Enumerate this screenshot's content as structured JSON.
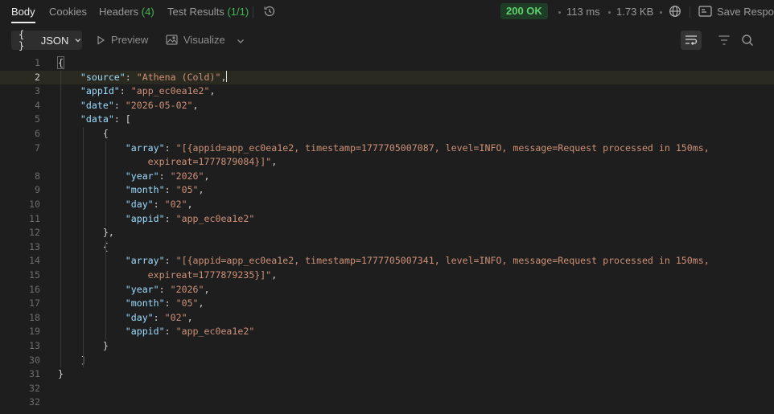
{
  "tabs": [
    {
      "label": "Body",
      "count": "",
      "active": true
    },
    {
      "label": "Cookies",
      "count": "",
      "active": false
    },
    {
      "label": "Headers",
      "count": "(4)",
      "active": false
    },
    {
      "label": "Test Results",
      "count": "(1/1)",
      "active": false
    }
  ],
  "response": {
    "status": "200 OK",
    "time": "113 ms",
    "size": "1.73 KB",
    "save_label": "Save Respo"
  },
  "toolbar": {
    "format_braces": "{ }",
    "format_label": "JSON",
    "preview_label": "Preview",
    "visualize_label": "Visualize"
  },
  "icons": {
    "history": "history-icon",
    "globe": "globe-icon",
    "save": "save-icon",
    "wrap": "wrap-lines-icon",
    "filter": "filter-icon",
    "search": "search-icon"
  },
  "colors": {
    "status_bg": "#1f3d26",
    "status_fg": "#5fd16f",
    "key": "#9cdcfe",
    "string": "#ce9178"
  },
  "editor": {
    "current_line": "2",
    "lines": [
      {
        "n": "1",
        "tokens": [
          [
            "p",
            "{"
          ]
        ]
      },
      {
        "n": "2",
        "tokens": [
          [
            "p",
            "    "
          ],
          [
            "k",
            "\"source\""
          ],
          [
            "p",
            ": "
          ],
          [
            "s",
            "\"Athena (Cold)\""
          ],
          [
            "p",
            ","
          ]
        ]
      },
      {
        "n": "3",
        "tokens": [
          [
            "p",
            "    "
          ],
          [
            "k",
            "\"appId\""
          ],
          [
            "p",
            ": "
          ],
          [
            "s",
            "\"app_ec0ea1e2\""
          ],
          [
            "p",
            ","
          ]
        ]
      },
      {
        "n": "4",
        "tokens": [
          [
            "p",
            "    "
          ],
          [
            "k",
            "\"date\""
          ],
          [
            "p",
            ": "
          ],
          [
            "s",
            "\"2026-05-02\""
          ],
          [
            "p",
            ","
          ]
        ]
      },
      {
        "n": "5",
        "tokens": [
          [
            "p",
            "    "
          ],
          [
            "k",
            "\"data\""
          ],
          [
            "p",
            ": ["
          ]
        ]
      },
      {
        "n": "6",
        "tokens": [
          [
            "p",
            "        {"
          ]
        ]
      },
      {
        "n": "7",
        "tokens": [
          [
            "p",
            "            "
          ],
          [
            "k",
            "\"array\""
          ],
          [
            "p",
            ": "
          ],
          [
            "s",
            "\"[{appid=app_ec0ea1e2, timestamp=1777705007087, level=INFO, message=Request processed in 150ms,"
          ]
        ]
      },
      {
        "n": "",
        "tokens": [
          [
            "s",
            "                expireat=1777879084}]\""
          ],
          [
            "p",
            ","
          ]
        ]
      },
      {
        "n": "8",
        "tokens": [
          [
            "p",
            "            "
          ],
          [
            "k",
            "\"year\""
          ],
          [
            "p",
            ": "
          ],
          [
            "s",
            "\"2026\""
          ],
          [
            "p",
            ","
          ]
        ]
      },
      {
        "n": "9",
        "tokens": [
          [
            "p",
            "            "
          ],
          [
            "k",
            "\"month\""
          ],
          [
            "p",
            ": "
          ],
          [
            "s",
            "\"05\""
          ],
          [
            "p",
            ","
          ]
        ]
      },
      {
        "n": "10",
        "tokens": [
          [
            "p",
            "            "
          ],
          [
            "k",
            "\"day\""
          ],
          [
            "p",
            ": "
          ],
          [
            "s",
            "\"02\""
          ],
          [
            "p",
            ","
          ]
        ]
      },
      {
        "n": "11",
        "tokens": [
          [
            "p",
            "            "
          ],
          [
            "k",
            "\"appid\""
          ],
          [
            "p",
            ": "
          ],
          [
            "s",
            "\"app_ec0ea1e2\""
          ]
        ]
      },
      {
        "n": "12",
        "tokens": [
          [
            "p",
            "        },"
          ]
        ]
      },
      {
        "n": "13",
        "tokens": [
          [
            "p",
            "        {"
          ]
        ]
      },
      {
        "n": "14",
        "tokens": [
          [
            "p",
            "            "
          ],
          [
            "k",
            "\"array\""
          ],
          [
            "p",
            ": "
          ],
          [
            "s",
            "\"[{appid=app_ec0ea1e2, timestamp=1777705007341, level=INFO, message=Request processed in 150ms,"
          ]
        ]
      },
      {
        "n": "15",
        "tokens": [
          [
            "s",
            "                expireat=1777879235}]\""
          ],
          [
            "p",
            ","
          ]
        ]
      },
      {
        "n": "16",
        "tokens": [
          [
            "p",
            "            "
          ],
          [
            "k",
            "\"year\""
          ],
          [
            "p",
            ": "
          ],
          [
            "s",
            "\"2026\""
          ],
          [
            "p",
            ","
          ]
        ]
      },
      {
        "n": "17",
        "tokens": [
          [
            "p",
            "            "
          ],
          [
            "k",
            "\"month\""
          ],
          [
            "p",
            ": "
          ],
          [
            "s",
            "\"05\""
          ],
          [
            "p",
            ","
          ]
        ]
      },
      {
        "n": "18",
        "tokens": [
          [
            "p",
            "            "
          ],
          [
            "k",
            "\"day\""
          ],
          [
            "p",
            ": "
          ],
          [
            "s",
            "\"02\""
          ],
          [
            "p",
            ","
          ]
        ]
      },
      {
        "n": "19",
        "tokens": [
          [
            "p",
            "            "
          ],
          [
            "k",
            "\"appid\""
          ],
          [
            "p",
            ": "
          ],
          [
            "s",
            "\"app_ec0ea1e2\""
          ]
        ]
      },
      {
        "n": "13",
        "tokens": [
          [
            "p",
            "        }"
          ]
        ]
      },
      {
        "n": "30",
        "tokens": [
          [
            "p",
            "    ]"
          ]
        ]
      },
      {
        "n": "31",
        "tokens": [
          [
            "p",
            "}"
          ]
        ]
      },
      {
        "n": "32",
        "tokens": []
      },
      {
        "n": "32",
        "tokens": []
      }
    ]
  }
}
